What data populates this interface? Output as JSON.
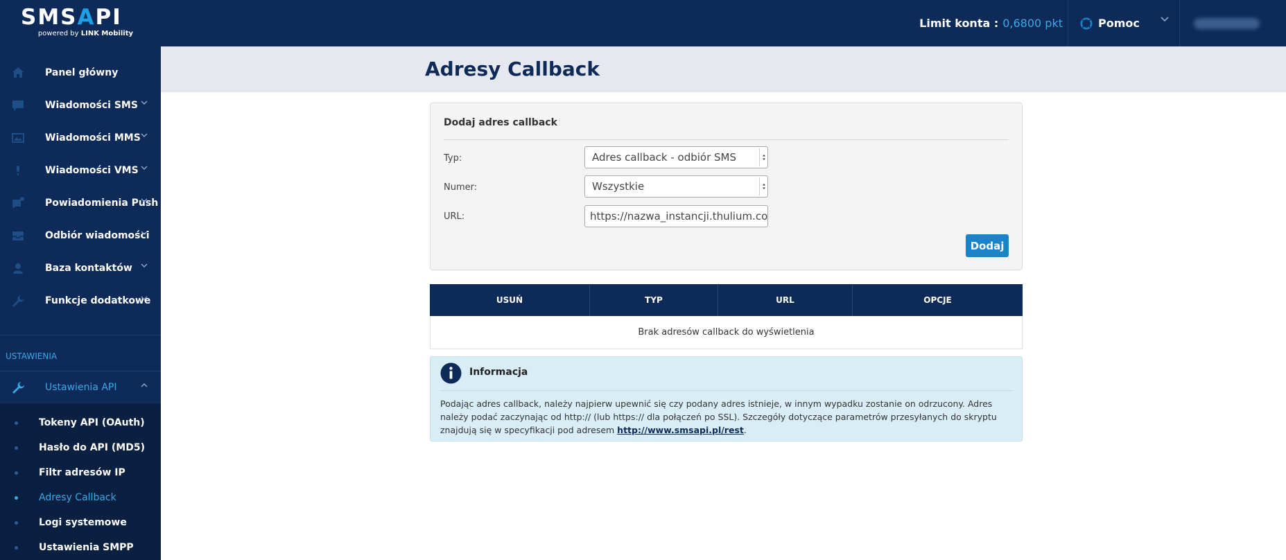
{
  "brand": {
    "logo_prefix": "SMS",
    "logo_accent": "A",
    "logo_suffix": "PI",
    "tagline_prefix": "powered by",
    "tagline_brand": "LINK Mobility"
  },
  "header": {
    "limit_label": "Limit konta :",
    "limit_value": "0,6800 pkt",
    "help_label": "Pomoc"
  },
  "sidebar": {
    "items": [
      {
        "label": "Panel główny",
        "icon": "home-icon"
      },
      {
        "label": "Wiadomości SMS",
        "icon": "chat-icon"
      },
      {
        "label": "Wiadomości MMS",
        "icon": "image-icon"
      },
      {
        "label": "Wiadomości VMS",
        "icon": "microphone-icon"
      },
      {
        "label": "Powiadomienia Push",
        "icon": "push-icon"
      },
      {
        "label": "Odbiór wiadomości",
        "icon": "inbox-icon"
      },
      {
        "label": "Baza kontaktów",
        "icon": "contacts-icon"
      },
      {
        "label": "Funkcje dodatkowe",
        "icon": "wrench-icon"
      }
    ],
    "section_label": "USTAWIENIA",
    "api_settings_label": "Ustawienia API",
    "sub_items": [
      {
        "label": "Tokeny API (OAuth)"
      },
      {
        "label": "Hasło do API (MD5)"
      },
      {
        "label": "Filtr adresów IP"
      },
      {
        "label": "Adresy Callback"
      },
      {
        "label": "Logi systemowe"
      },
      {
        "label": "Ustawienia SMPP"
      }
    ]
  },
  "page": {
    "title": "Adresy Callback"
  },
  "form": {
    "title": "Dodaj adres callback",
    "type_label": "Typ:",
    "type_value": "Adres callback - odbiór SMS",
    "number_label": "Numer:",
    "number_value": "Wszystkie",
    "url_label": "URL:",
    "url_value": "https://nazwa_instancji.thulium.com",
    "add_button": "Dodaj"
  },
  "table": {
    "headers": [
      "USUŃ",
      "TYP",
      "URL",
      "OPCJE"
    ],
    "empty_message": "Brak adresów callback do wyświetlenia"
  },
  "info": {
    "title": "Informacja",
    "text": "Podając adres callback, należy najpierw upewnić się czy podany adres istnieje, w innym wypadku zostanie on odrzucony. Adres należy podać zaczynając od http:// (lub https:// dla połączeń po SSL). Szczegóły dotyczące parametrów przesyłanych do skryptu znajdują się w specyfikacji pod adresem ",
    "link": "http://www.smsapi.pl/rest",
    "text_end": "."
  },
  "colors": {
    "navy": "#0d2a58",
    "accent": "#3aa8e8",
    "button": "#1a84c9",
    "info_bg": "#d8edf5"
  }
}
